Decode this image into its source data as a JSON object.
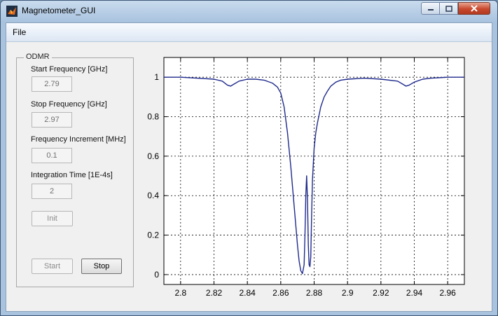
{
  "window": {
    "title": "Magnetometer_GUI"
  },
  "menu": {
    "file": "File"
  },
  "panel": {
    "title": "ODMR",
    "start_freq_label": "Start Frequency [GHz]",
    "start_freq_value": "2.79",
    "stop_freq_label": "Stop Frequency [GHz]",
    "stop_freq_value": "2.97",
    "freq_inc_label": "Frequency Increment [MHz]",
    "freq_inc_value": "0.1",
    "int_time_label": "Integration Time [1E-4s]",
    "int_time_value": "2",
    "init_label": "Init",
    "start_label": "Start",
    "stop_label": "Stop"
  },
  "chart_data": {
    "type": "line",
    "xlim": [
      2.79,
      2.97
    ],
    "ylim": [
      -0.05,
      1.1
    ],
    "grid": true,
    "x_ticks": [
      "2.8",
      "2.82",
      "2.84",
      "2.86",
      "2.88",
      "2.9",
      "2.92",
      "2.94",
      "2.96"
    ],
    "y_ticks": [
      "0",
      "0.2",
      "0.4",
      "0.6",
      "0.8",
      "1"
    ],
    "line_color": "#1f2a8c",
    "series": [
      {
        "x": [
          2.79,
          2.8,
          2.81,
          2.82,
          2.825,
          2.828,
          2.83,
          2.832,
          2.835,
          2.84,
          2.845,
          2.85,
          2.855,
          2.858,
          2.86,
          2.862,
          2.864,
          2.866,
          2.868,
          2.87,
          2.871,
          2.872,
          2.873,
          2.874,
          2.8745,
          2.875,
          2.8755,
          2.876,
          2.8765,
          2.877,
          2.8775,
          2.878,
          2.8785,
          2.879,
          2.88,
          2.881,
          2.882,
          2.884,
          2.886,
          2.888,
          2.89,
          2.893,
          2.896,
          2.9,
          2.91,
          2.92,
          2.93,
          2.933,
          2.935,
          2.937,
          2.94,
          2.945,
          2.95,
          2.96,
          2.97
        ],
        "y": [
          1.0,
          1.0,
          0.995,
          0.99,
          0.98,
          0.96,
          0.955,
          0.965,
          0.98,
          0.99,
          0.99,
          0.985,
          0.97,
          0.95,
          0.92,
          0.85,
          0.72,
          0.55,
          0.35,
          0.15,
          0.07,
          0.02,
          0.005,
          0.05,
          0.2,
          0.4,
          0.5,
          0.38,
          0.15,
          0.05,
          0.04,
          0.09,
          0.3,
          0.48,
          0.64,
          0.72,
          0.77,
          0.85,
          0.9,
          0.93,
          0.955,
          0.975,
          0.985,
          0.99,
          0.995,
          0.99,
          0.98,
          0.965,
          0.955,
          0.96,
          0.975,
          0.99,
          0.995,
          1.0,
          1.0
        ]
      }
    ]
  }
}
